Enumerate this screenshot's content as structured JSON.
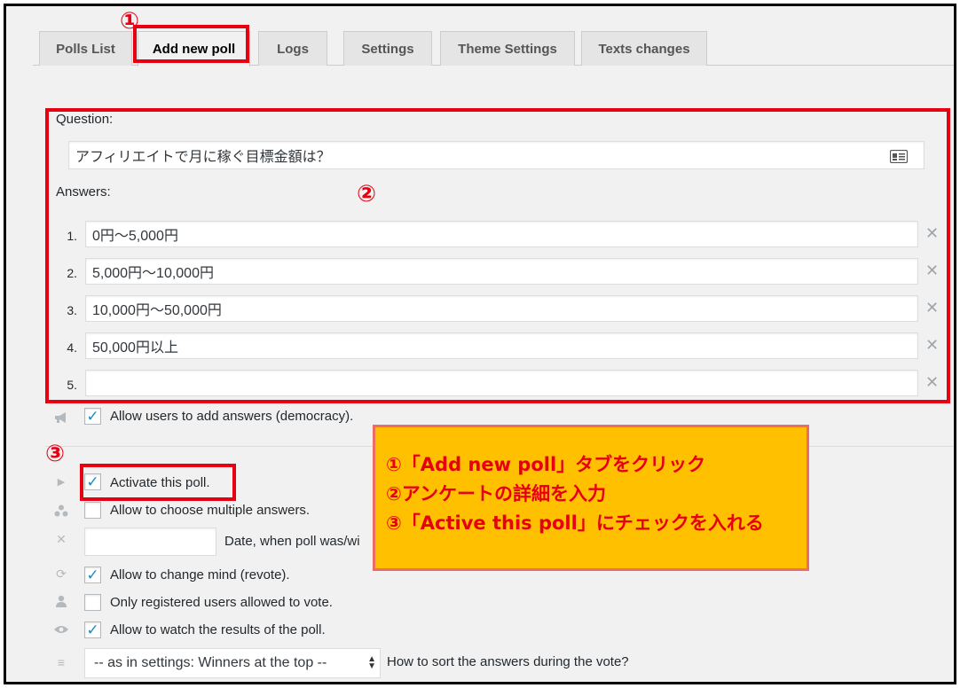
{
  "tabs": [
    {
      "label": "Polls List"
    },
    {
      "label": "Add new poll"
    },
    {
      "label": "Logs"
    },
    {
      "label": "Settings"
    },
    {
      "label": "Theme Settings"
    },
    {
      "label": "Texts changes"
    }
  ],
  "markers": {
    "one": "①",
    "two": "②",
    "three": "③"
  },
  "question": {
    "label": "Question:",
    "value": "アフィリエイトで月に稼ぐ目標金額は？"
  },
  "answers": {
    "label": "Answers:",
    "items": [
      {
        "num": "1.",
        "value": "0円〜5,000円"
      },
      {
        "num": "2.",
        "value": "5,000円〜10,000円"
      },
      {
        "num": "3.",
        "value": "10,000円〜50,000円"
      },
      {
        "num": "4.",
        "value": "50,000円以上"
      },
      {
        "num": "5.",
        "value": ""
      }
    ],
    "delete_glyph": "✕"
  },
  "options": {
    "democracy": {
      "label": "Allow users to add answers (democracy).",
      "checked": true
    },
    "activate": {
      "label": "Activate this poll.",
      "checked": true
    },
    "multiple": {
      "label": "Allow to choose multiple answers.",
      "checked": false
    },
    "end_date": {
      "label": "Date, when poll was/wi",
      "value": ""
    },
    "revote": {
      "label": "Allow to change mind (revote).",
      "checked": true
    },
    "registered": {
      "label": "Only registered users allowed to vote.",
      "checked": false
    },
    "watch_results": {
      "label": "Allow to watch the results of the poll.",
      "checked": true
    },
    "sort": {
      "selected": "-- as in settings: Winners at the top --",
      "label": "How to sort the answers during the vote?"
    }
  },
  "check_glyph": "✓",
  "note": {
    "lines": [
      "①「Add new poll」タブをクリック",
      "②アンケートの詳細を入力",
      "③「Active this poll」にチェックを入れる"
    ]
  },
  "colors": {
    "highlight_red": "#e60012",
    "note_bg": "#ffc000",
    "check_blue": "#1e8cbe"
  }
}
